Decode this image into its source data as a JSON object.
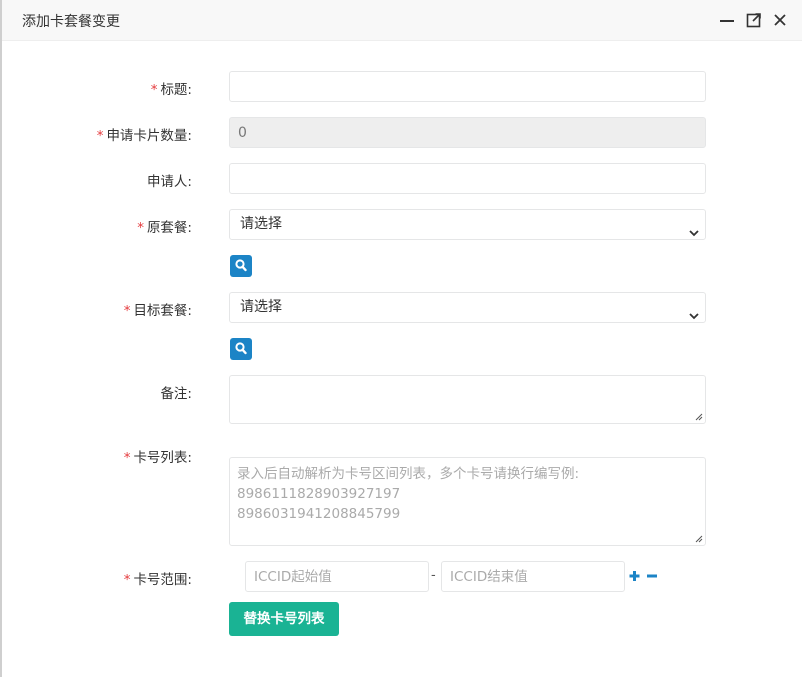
{
  "dialog": {
    "title": "添加卡套餐变更",
    "controls": [
      "minimize-icon",
      "maximize-icon",
      "close-icon"
    ]
  },
  "form": {
    "required_mark": "*",
    "title": {
      "label": "标题:",
      "value": ""
    },
    "card_count": {
      "label": "申请卡片数量:",
      "value": "0"
    },
    "applicant": {
      "label": "申请人:",
      "value": ""
    },
    "original_plan": {
      "label": "原套餐:",
      "selected": "请选择"
    },
    "target_plan": {
      "label": "目标套餐:",
      "selected": "请选择"
    },
    "remark": {
      "label": "备注:",
      "value": ""
    },
    "card_list": {
      "label": "卡号列表:",
      "placeholder_line1": "录入后自动解析为卡号区间列表，多个卡号请换行编写例:",
      "placeholder_line2": "8986111828903927197",
      "placeholder_line3": "8986031941208845799"
    },
    "card_range": {
      "label": "卡号范围:",
      "start_placeholder": "ICCID起始值",
      "separator": "-",
      "end_placeholder": "ICCID结束值"
    },
    "replace_button": "替换卡号列表"
  },
  "colors": {
    "required": "#e4393c",
    "search_button": "#1c84c6",
    "primary_button": "#1ab394",
    "icon_blue": "#1c84c6"
  }
}
